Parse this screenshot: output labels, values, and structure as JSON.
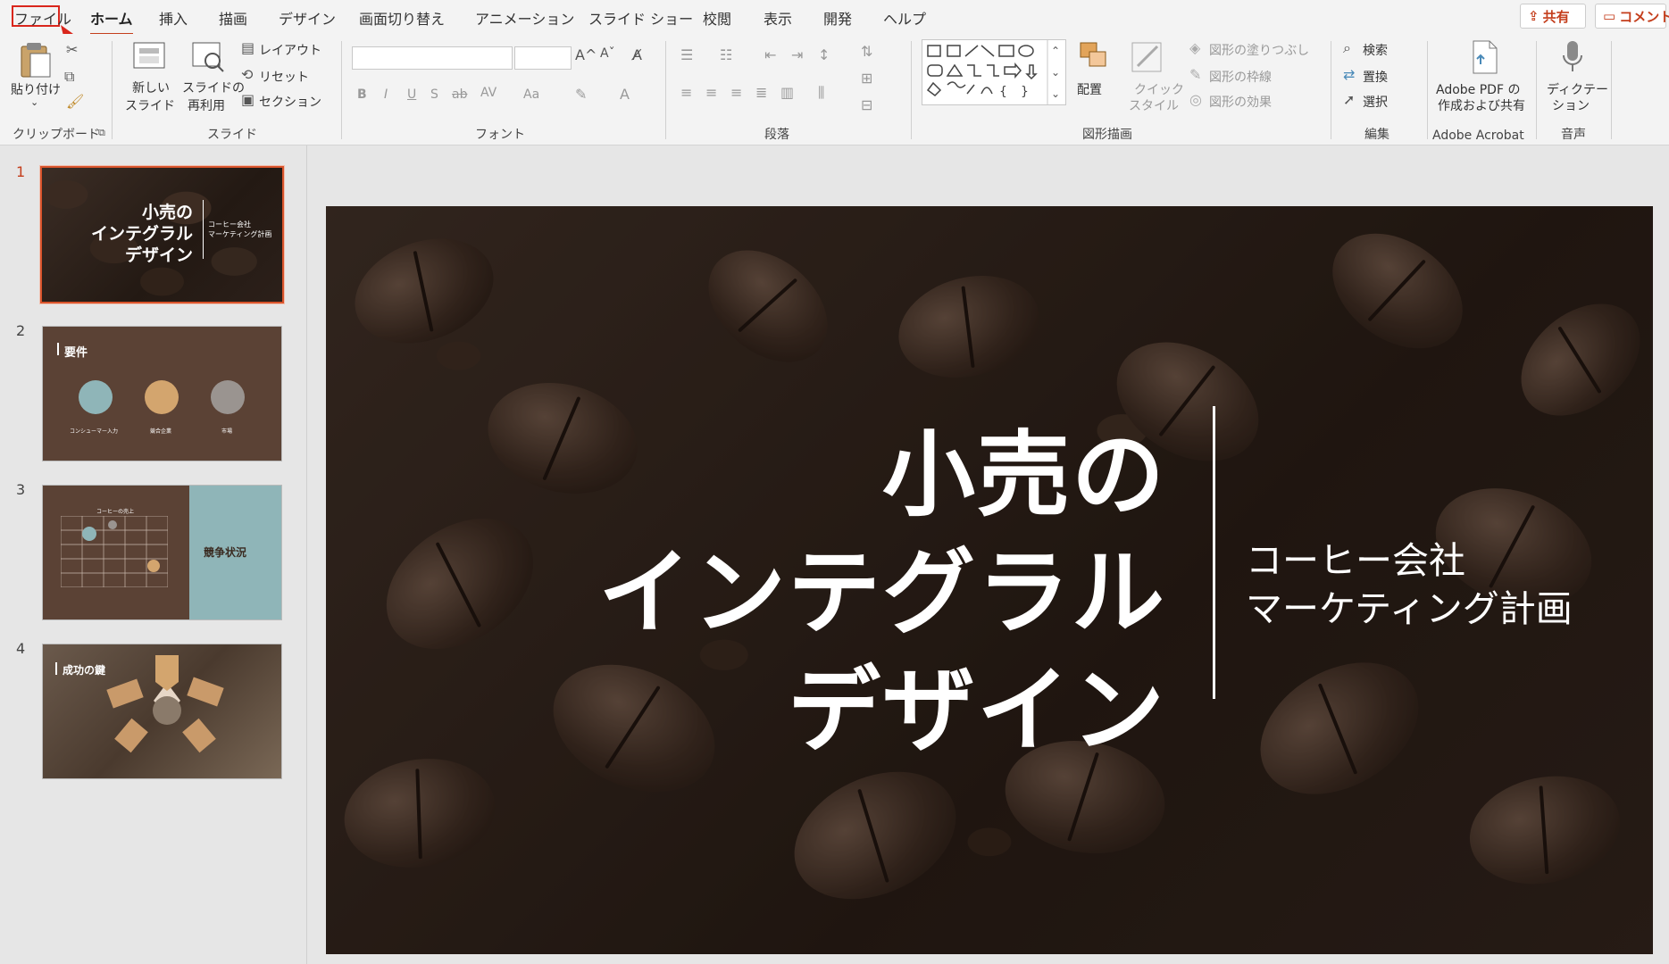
{
  "tabs": [
    {
      "label": "ファイル"
    },
    {
      "label": "ホーム"
    },
    {
      "label": "挿入"
    },
    {
      "label": "描画"
    },
    {
      "label": "デザイン"
    },
    {
      "label": "画面切り替え"
    },
    {
      "label": "アニメーション"
    },
    {
      "label": "スライド ショー"
    },
    {
      "label": "校閲"
    },
    {
      "label": "表示"
    },
    {
      "label": "開発"
    },
    {
      "label": "ヘルプ"
    }
  ],
  "header": {
    "share_label": "共有",
    "comment_label": "コメント"
  },
  "ribbon": {
    "clipboard": {
      "paste": "貼り付け",
      "group": "クリップボード"
    },
    "slides": {
      "new_slide_1": "新しい",
      "new_slide_2": "スライド",
      "reuse_1": "スライドの",
      "reuse_2": "再利用",
      "layout": "レイアウト",
      "reset": "リセット",
      "section": "セクション",
      "group": "スライド"
    },
    "font": {
      "group": "フォント",
      "buttons": [
        "B",
        "I",
        "U",
        "S",
        "ab",
        "AV",
        "Aa"
      ]
    },
    "paragraph": {
      "group": "段落"
    },
    "drawing": {
      "arrange": "配置",
      "quick_1": "クイック",
      "quick_2": "スタイル",
      "fill": "図形の塗りつぶし",
      "outline": "図形の枠線",
      "effect": "図形の効果",
      "group": "図形描画"
    },
    "editing": {
      "find": "検索",
      "replace": "置換",
      "select": "選択",
      "group": "編集"
    },
    "acrobat": {
      "line1": "Adobe PDF の",
      "line2": "作成および共有",
      "group": "Adobe Acrobat"
    },
    "voice": {
      "line1": "ディクテー",
      "line2": "ション",
      "group": "音声"
    }
  },
  "slides": [
    {
      "num": "1",
      "title": "小売の\nインテグラル\nデザイン",
      "subtitle": "コーヒー会社\nマーケティング計画"
    },
    {
      "num": "2",
      "title": "要件",
      "labels": [
        "コンシューマー入力",
        "競合企業",
        "市場"
      ]
    },
    {
      "num": "3",
      "title": "競争状況",
      "chart_title": "コーヒーの売上"
    },
    {
      "num": "4",
      "title": "成功の鍵"
    }
  ],
  "main_slide": {
    "title_lines": [
      "小売の",
      "インテグラル",
      "デザイン"
    ],
    "subtitle_lines": [
      "コーヒー会社",
      "マーケティング計画"
    ]
  }
}
